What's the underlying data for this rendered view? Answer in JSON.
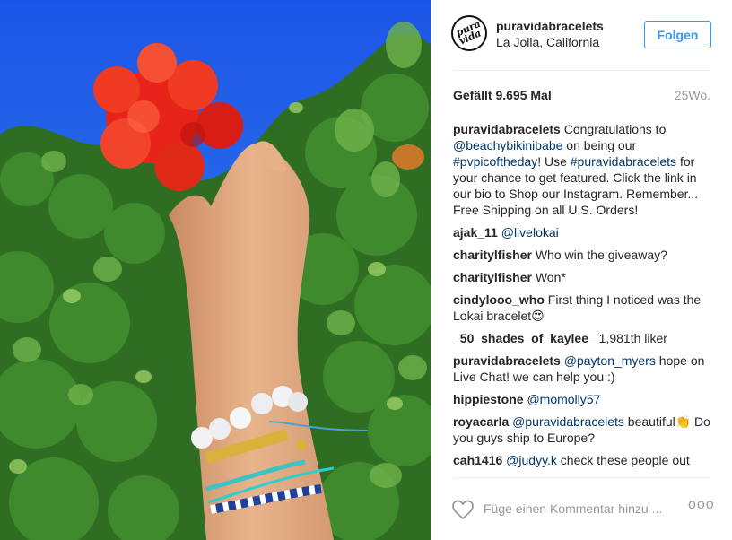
{
  "post": {
    "username": "puravidabracelets",
    "location": "La Jolla, California",
    "follow_label": "Folgen",
    "avatar_text_top": "pura",
    "avatar_text_bottom": "vida",
    "likes": "Gefällt 9.695 Mal",
    "age": "25Wo."
  },
  "caption": {
    "user": "puravidabracelets",
    "t1": " Congratulations to ",
    "mention1": "@beachybikinibabe",
    "t2": " on being our ",
    "tag1": "#pvpicoftheday",
    "t3": "! Use ",
    "tag2": "#puravidabracelets",
    "t4": " for your chance to get featured. Click the link in our bio to Shop our Instagram. Remember... Free Shipping on all U.S. Orders!"
  },
  "comments": [
    {
      "user": "ajak_11",
      "mention": "@livelokai",
      "text": ""
    },
    {
      "user": "charitylfisher",
      "mention": "",
      "text": " Who win the giveaway?"
    },
    {
      "user": "charitylfisher",
      "mention": "",
      "text": " Won*"
    },
    {
      "user": "cindylooo_who",
      "mention": "",
      "text": " First thing I noticed was the Lokai bracelet😍"
    },
    {
      "user": "_50_shades_of_kaylee_",
      "mention": "",
      "text": " 1,981th liker"
    },
    {
      "user": "puravidabracelets",
      "mention": "@payton_myers",
      "text": " hope on Live Chat! we can help you :)"
    },
    {
      "user": "hippiestone",
      "mention": "@momolly57",
      "text": ""
    },
    {
      "user": "royacarla",
      "mention": "@puravidabracelets",
      "text": " beautiful👏 Do you guys ship to Europe?"
    },
    {
      "user": "cah1416",
      "mention": "@judyy.k",
      "text": " check these people out"
    }
  ],
  "footer": {
    "comment_placeholder": "Füge einen Kommentar hinzu ...",
    "more_label": "ooo",
    "heart_icon": "heart-outline-icon"
  },
  "colors": {
    "follow_blue": "#3897f0",
    "mention_blue": "#003569",
    "sky": "#1f5fe8",
    "flower": "#e8241a"
  }
}
